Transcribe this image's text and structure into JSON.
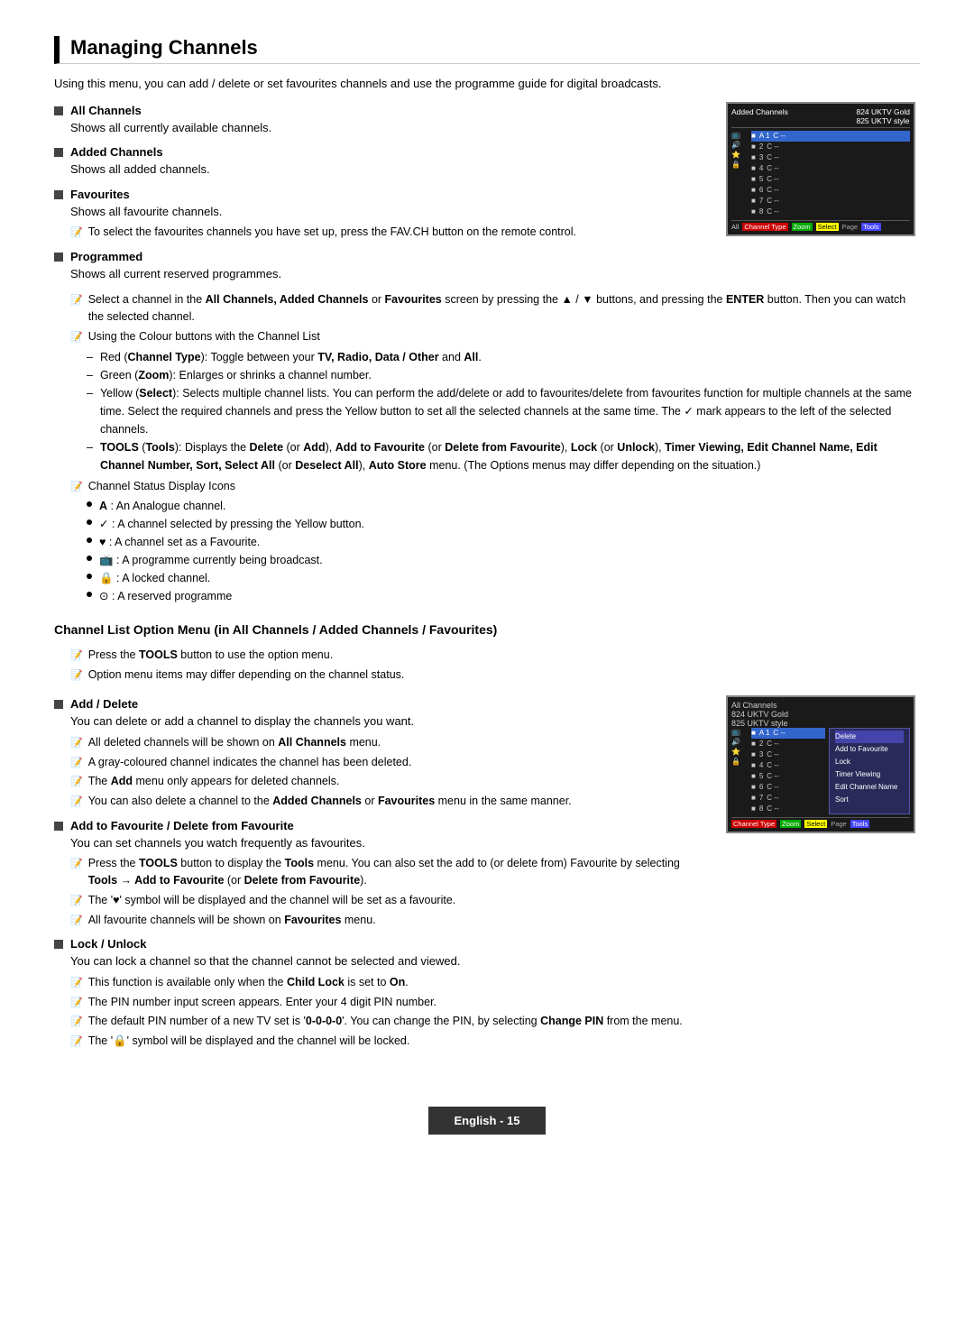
{
  "page": {
    "title": "Managing Channels",
    "footer_label": "English - 15"
  },
  "intro": {
    "text": "Using this menu, you can add / delete or set favourites channels and use the programme guide for digital broadcasts."
  },
  "sections": [
    {
      "id": "all-channels",
      "title": "All Channels",
      "body": "Shows all currently available channels."
    },
    {
      "id": "added-channels",
      "title": "Added Channels",
      "body": "Shows all added channels."
    },
    {
      "id": "favourites",
      "title": "Favourites",
      "body": "Shows all favourite channels.",
      "note": "To select the favourites channels you have set up, press the FAV.CH button on the remote control."
    },
    {
      "id": "programmed",
      "title": "Programmed",
      "body": "Shows all current reserved programmes."
    }
  ],
  "notes": [
    {
      "id": "note-select-channel",
      "text": "Select a channel in the All Channels, Added Channels or Favourites screen by pressing the ▲ / ▼ buttons, and pressing the ENTER button. Then you can watch the selected channel."
    },
    {
      "id": "note-colour-buttons",
      "text": "Using the Colour buttons with the Channel List"
    }
  ],
  "colour_buttons": [
    {
      "colour": "Red",
      "text": "(Channel Type): Toggle between your TV, Radio, Data / Other and All."
    },
    {
      "colour": "Green",
      "text": "(Zoom): Enlarges or shrinks a channel number."
    },
    {
      "colour": "Yellow",
      "text": "(Select): Selects multiple channel lists. You can perform the add/delete or add to favourites/delete from favourites function for multiple channels at the same time. Select the required channels and press the Yellow button to set all the selected channels at the same time. The ✓ mark appears to the left of the selected channels."
    },
    {
      "colour": "TOOLS",
      "text": "(Tools): Displays the Delete (or Add), Add to Favourite (or Delete from Favourite), Lock (or Unlock), Timer Viewing, Edit Channel Name, Edit Channel Number, Sort, Select All (or Deselect All), Auto Store menu. (The Options menus may differ depending on the situation.)"
    }
  ],
  "channel_status_icons": {
    "heading": "Channel Status Display Icons",
    "icons": [
      {
        "icon": "A",
        "desc": ": An Analogue channel."
      },
      {
        "icon": "✓",
        "desc": ": A channel selected by pressing the Yellow button."
      },
      {
        "icon": "♥",
        "desc": ": A channel set as a Favourite."
      },
      {
        "icon": "📺",
        "desc": ": A programme currently being broadcast."
      },
      {
        "icon": "🔒",
        "desc": ": A locked channel."
      },
      {
        "icon": "⊙",
        "desc": ": A reserved programme"
      }
    ]
  },
  "subsection": {
    "title": "Channel List Option Menu (in All Channels / Added Channels / Favourites)"
  },
  "subsection_notes": [
    {
      "text": "Press the TOOLS button to use the option menu."
    },
    {
      "text": "Option menu items may differ depending on the channel status."
    }
  ],
  "sub_sections": [
    {
      "id": "add-delete",
      "title": "Add / Delete",
      "body": "You can delete or add a channel to display the channels you want.",
      "notes": [
        "All deleted channels will be shown on All Channels menu.",
        "A gray-coloured channel indicates the channel has been deleted.",
        "The Add menu only appears for deleted channels.",
        "You can also delete a channel to the Added Channels or Favourites menu in the same manner."
      ]
    },
    {
      "id": "add-to-favourite",
      "title": "Add to Favourite / Delete from Favourite",
      "body": "You can set channels you watch frequently as favourites.",
      "notes": [
        "Press the TOOLS button to display the Tools menu. You can also set the add to (or delete from) Favourite by selecting Tools → Add to Favourite (or Delete from Favourite).",
        "The '♥' symbol will be displayed and the channel will be set as a favourite.",
        "All favourite channels will be shown on Favourites menu."
      ]
    },
    {
      "id": "lock-unlock",
      "title": "Lock / Unlock",
      "body": "You can lock a channel so that the channel cannot be selected and viewed.",
      "notes": [
        "This function is available only when the Child Lock is set to On.",
        "The PIN number input screen appears. Enter your 4 digit PIN number.",
        "The default PIN number of a new TV set is '0-0-0-0'. You can change the PIN, by selecting Change PIN from the menu.",
        "The '🔒' symbol will be displayed and the channel will be locked."
      ]
    }
  ],
  "tv_screen_1": {
    "top_left": "Added Channels",
    "channels": [
      {
        "num": "1",
        "name": "C --",
        "highlighted": true
      },
      {
        "num": "2",
        "name": "C --"
      },
      {
        "num": "3",
        "name": "C --"
      },
      {
        "num": "4",
        "name": "C --"
      },
      {
        "num": "5",
        "name": "C --"
      },
      {
        "num": "6",
        "name": "C --"
      },
      {
        "num": "7",
        "name": "C --"
      },
      {
        "num": "8",
        "name": "C --"
      }
    ],
    "top_right_line1": "824  UKTV Gold",
    "top_right_line2": "825  UKTV style",
    "bottom_bar": "All  ChannelType  Zoom  Select  Page  Tools"
  },
  "tv_screen_2": {
    "top_right_line1": "824  UKTV Gold",
    "top_right_line2": "825  UKTV style",
    "channels": [
      {
        "num": "1",
        "name": "C --",
        "highlighted": true
      },
      {
        "num": "2",
        "name": "C --"
      },
      {
        "num": "3",
        "name": "C --"
      },
      {
        "num": "4",
        "name": "C --"
      },
      {
        "num": "5",
        "name": "C --"
      },
      {
        "num": "6",
        "name": "C --"
      },
      {
        "num": "7",
        "name": "C --"
      },
      {
        "num": "8",
        "name": "C --"
      }
    ],
    "menu_items": [
      {
        "label": "Delete",
        "selected": true
      },
      {
        "label": "Add to Favourite"
      },
      {
        "label": "Lock"
      },
      {
        "label": "Timer Viewing"
      },
      {
        "label": "Edit Channel Name"
      },
      {
        "label": "Sort"
      }
    ],
    "bottom_bar": "ChannelType  Zoom  Select  Page  Tools"
  }
}
